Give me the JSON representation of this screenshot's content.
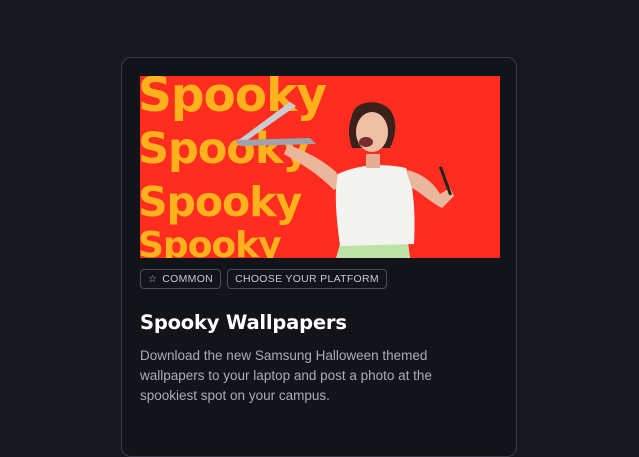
{
  "card": {
    "banner": {
      "words": [
        "Spooky",
        "Spooky",
        "Spooky",
        "Spooky"
      ],
      "colors": {
        "background": "#ff2d1f",
        "text": "#ffb21c"
      }
    },
    "tags": [
      {
        "label": "COMMON",
        "icon": "star-icon"
      },
      {
        "label": "CHOOSE YOUR PLATFORM"
      }
    ],
    "title": "Spooky Wallpapers",
    "description": "Download the new Samsung Halloween themed wallpapers to your laptop and post a photo at the spookiest spot on your campus."
  }
}
